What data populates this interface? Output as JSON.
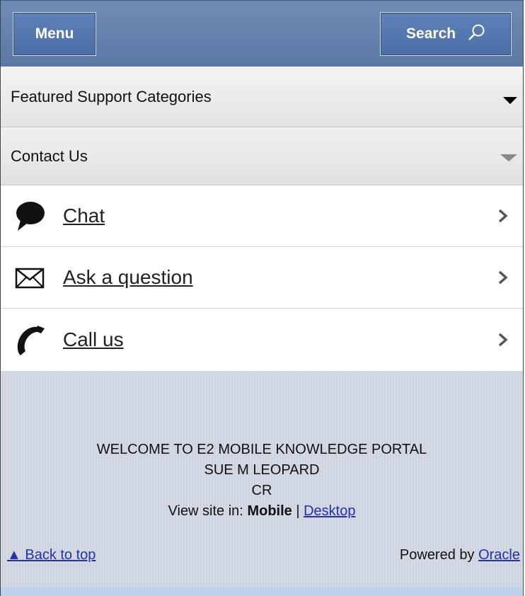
{
  "header": {
    "menu_label": "Menu",
    "search_label": "Search"
  },
  "accordion": {
    "featured": "Featured Support Categories",
    "contact": "Contact Us"
  },
  "contact_items": [
    {
      "label": "Chat",
      "icon": "chat-bubble-icon"
    },
    {
      "label": "Ask a question",
      "icon": "envelope-icon"
    },
    {
      "label": "Call us",
      "icon": "phone-icon"
    }
  ],
  "footer": {
    "welcome": "WELCOME TO E2 MOBILE KNOWLEDGE PORTAL",
    "user": "SUE M LEOPARD",
    "code": "CR",
    "view_prefix": "View site in:",
    "view_mobile": "Mobile",
    "view_sep": "|",
    "view_desktop": "Desktop",
    "back_to_top": "▲ Back to top",
    "powered_prefix": "Powered by",
    "powered_link": "Oracle"
  },
  "colors": {
    "header_blue": "#5a78a4",
    "button_blue": "#4a6fa6",
    "link_blue": "#2332a8",
    "footer_bg": "#d5dbe5"
  }
}
